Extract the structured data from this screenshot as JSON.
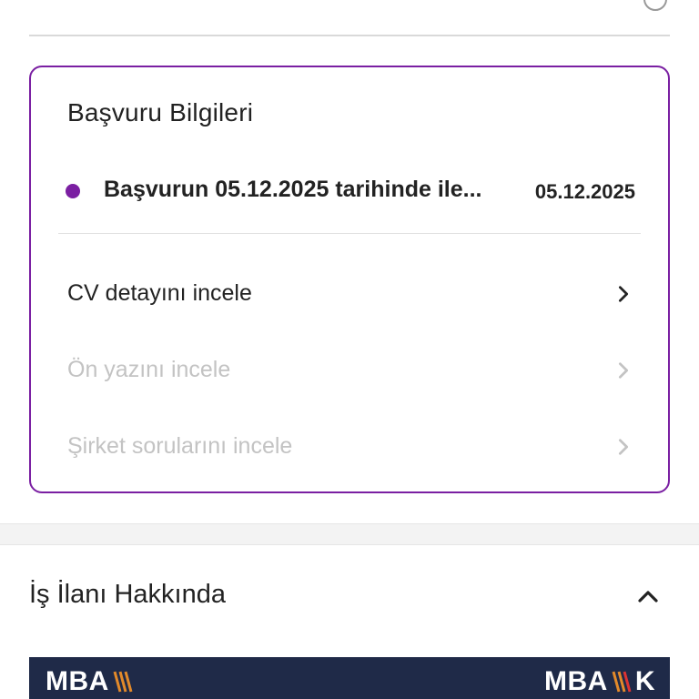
{
  "application_card": {
    "title": "Başvuru Bilgileri",
    "status_text": "Başvurun 05.12.2025 tarihinde ile...",
    "status_date": "05.12.2025",
    "links": [
      {
        "label": "CV detayını incele",
        "enabled": true
      },
      {
        "label": "Ön yazını incele",
        "enabled": false
      },
      {
        "label": "Şirket sorularını incele",
        "enabled": false
      }
    ]
  },
  "job_section": {
    "title": "İş İlanı Hakkında"
  },
  "banner": {
    "logo_left": "MBA",
    "logo_right": "MBA",
    "logo_right_suffix": "K"
  },
  "colors": {
    "accent": "#7b1fa2",
    "banner_bg": "#1f2a48",
    "logo_accent": "#e38a2a",
    "disabled_text": "#c3c3c3"
  }
}
